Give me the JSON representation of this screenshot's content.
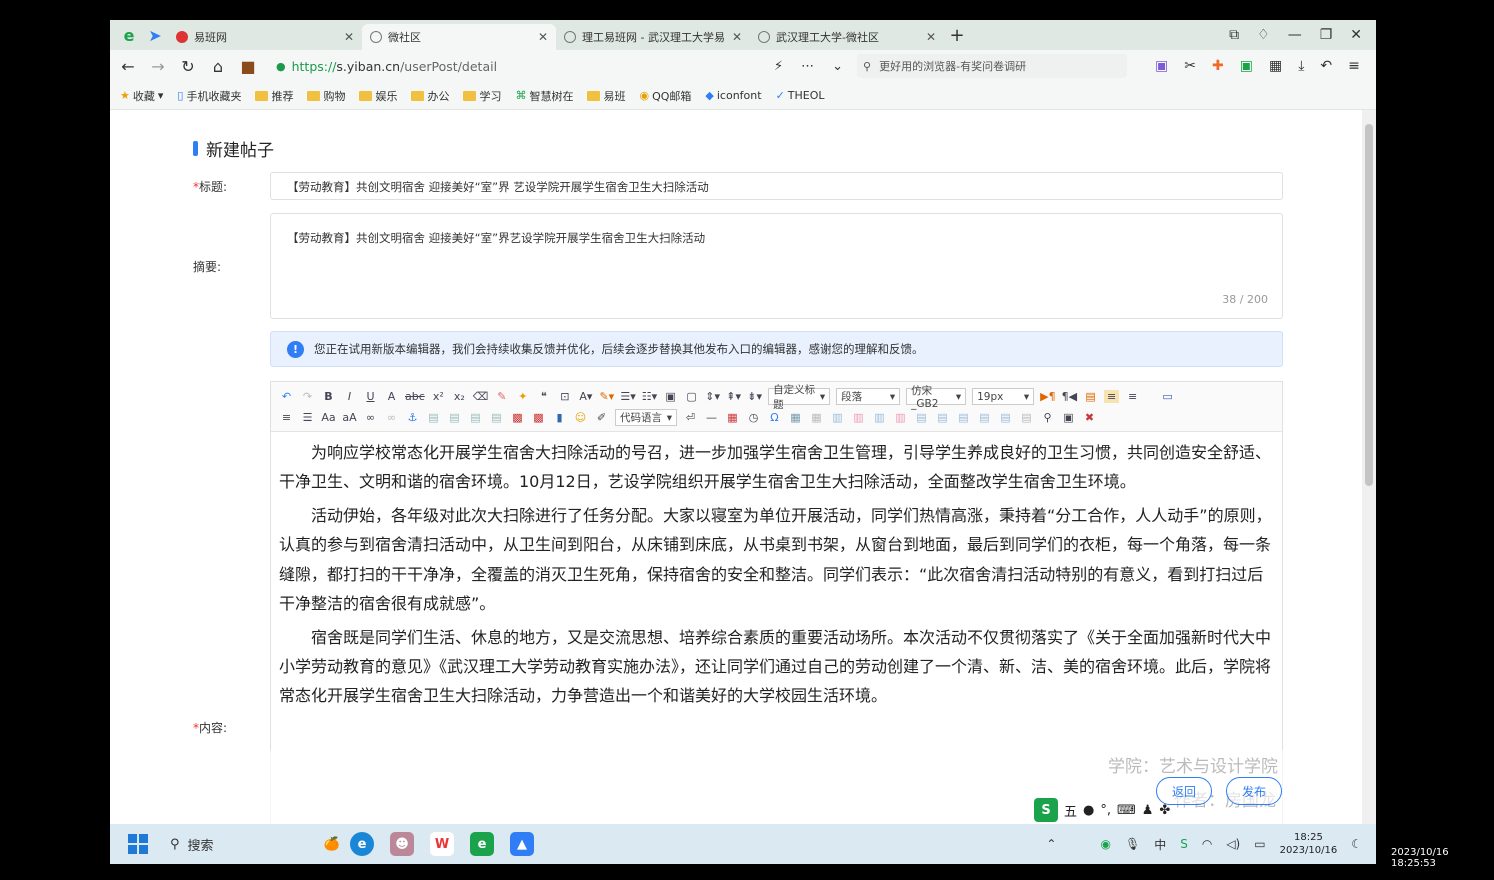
{
  "tabs": [
    {
      "title": "易班网",
      "active": false
    },
    {
      "title": "微社区",
      "active": true
    },
    {
      "title": "理工易班网 - 武汉理工大学易",
      "active": false
    },
    {
      "title": "武汉理工大学-微社区",
      "active": false
    }
  ],
  "address": {
    "scheme": "https://",
    "host": "s.yiban.cn",
    "path": "/userPost/detail"
  },
  "search_hint": "更好用的浏览器-有奖问卷调研",
  "bookmarks": [
    "收藏",
    "手机收藏夹",
    "推荐",
    "购物",
    "娱乐",
    "办公",
    "学习",
    "智慧树在",
    "易班",
    "QQ邮箱",
    "iconfont",
    "THEOL"
  ],
  "page": {
    "heading": "新建帖子",
    "title_label": "标题:",
    "title_value": "【劳动教育】共创文明宿舍 迎接美好“室”界 艺设学院开展学生宿舍卫生大扫除活动",
    "summary_label": "摘要:",
    "summary_value": "【劳动教育】共创文明宿舍 迎接美好“室”界艺设学院开展学生宿舍卫生大扫除活动",
    "summary_count": "38 / 200",
    "notice": "您正在试用新版本编辑器，我们会持续收集反馈并优化，后续会逐步替换其他发布入口的编辑器，感谢您的理解和反馈。",
    "content_label": "内容:",
    "toolbar": {
      "style_select": "自定义标题",
      "para_select": "段落",
      "font_select": "仿宋_GB2",
      "size_select": "19px",
      "code_select": "代码语言"
    },
    "paragraphs": [
      "为响应学校常态化开展学生宿舍大扫除活动的号召，进一步加强学生宿舍卫生管理，引导学生养成良好的卫生习惯，共同创造安全舒适、干净卫生、文明和谐的宿舍环境。10月12日，艺设学院组织开展学生宿舍卫生大扫除活动，全面整改学生宿舍卫生环境。",
      "活动伊始，各年级对此次大扫除进行了任务分配。大家以寝室为单位开展活动，同学们热情高涨，秉持着“分工合作，人人动手”的原则，认真的参与到宿舍清扫活动中，从卫生间到阳台，从床铺到床底，从书桌到书架，从窗台到地面，最后到同学们的衣柜，每一个角落，每一条缝隙，都打扫的干干净净，全覆盖的消灭卫生死角，保持宿舍的安全和整洁。同学们表示：“此次宿舍清扫活动特别的有意义，看到打扫过后干净整洁的宿舍很有成就感”。",
      "宿舍既是同学们生活、休息的地方，又是交流思想、培养综合素质的重要活动场所。本次活动不仅贯彻落实了《关于全面加强新时代大中小学劳动教育的意见》《武汉理工大学劳动教育实施办法》，还让同学们通过自己的劳动创建了一个清、新、洁、美的宿舍环境。此后，学院将常态化开展学生宿舍卫生大扫除活动，力争营造出一个和谐美好的大学校园生活环境。"
    ],
    "college_line": "学院：艺术与设计学院",
    "author_line": "作者：房国龙",
    "back_button": "返回",
    "publish_button": "发布"
  },
  "ime": {
    "mode": "五"
  },
  "taskbar": {
    "search": "搜索",
    "time": "18:25",
    "date": "2023/10/16"
  },
  "recording_timestamp": "2023/10/16 18:25:53"
}
